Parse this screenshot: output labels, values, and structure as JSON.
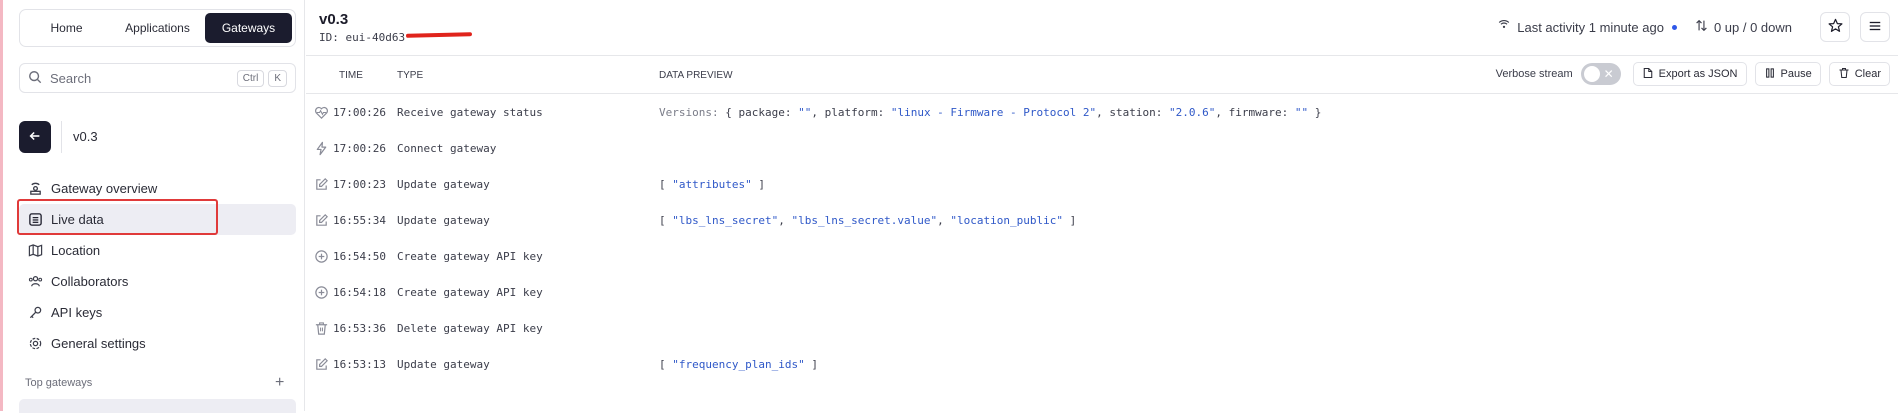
{
  "sidebar": {
    "tabs": [
      {
        "label": "Home"
      },
      {
        "label": "Applications"
      },
      {
        "label": "Gateways"
      }
    ],
    "search": {
      "placeholder": "Search",
      "key1": "Ctrl",
      "key2": "K"
    },
    "entity": {
      "name": "v0.3"
    },
    "nav": [
      {
        "label": "Gateway overview",
        "icon": "gateway-icon"
      },
      {
        "label": "Live data",
        "icon": "list-icon"
      },
      {
        "label": "Location",
        "icon": "map-icon"
      },
      {
        "label": "Collaborators",
        "icon": "users-icon"
      },
      {
        "label": "API keys",
        "icon": "key-icon"
      },
      {
        "label": "General settings",
        "icon": "gear-icon"
      }
    ],
    "section": {
      "title": "Top gateways"
    }
  },
  "header": {
    "title": "v0.3",
    "id_label": "ID:",
    "id_value": "eui-40d63",
    "activity": "Last activity 1 minute ago",
    "traffic": "0 up / 0 down"
  },
  "table": {
    "columns": {
      "time": "TIME",
      "type": "TYPE",
      "preview": "DATA PREVIEW"
    },
    "controls": {
      "verbose": "Verbose stream",
      "export": "Export as JSON",
      "pause": "Pause",
      "clear": "Clear"
    },
    "rows": [
      {
        "icon": "heartbeat-icon",
        "time": "17:00:26",
        "type": "Receive gateway status",
        "preview_prefix": "Versions: ",
        "preview": "{ package: \"\", platform: \"linux - Firmware - Protocol 2\", station: \"2.0.6\", firmware: \"\" }"
      },
      {
        "icon": "bolt-icon",
        "time": "17:00:26",
        "type": "Connect gateway",
        "preview_prefix": "",
        "preview": ""
      },
      {
        "icon": "edit-icon",
        "time": "17:00:23",
        "type": "Update gateway",
        "preview_prefix": "",
        "preview": "[ \"attributes\" ]"
      },
      {
        "icon": "edit-icon",
        "time": "16:55:34",
        "type": "Update gateway",
        "preview_prefix": "",
        "preview": "[ \"lbs_lns_secret\", \"lbs_lns_secret.value\", \"location_public\" ]"
      },
      {
        "icon": "plus-circle-icon",
        "time": "16:54:50",
        "type": "Create gateway API key",
        "preview_prefix": "",
        "preview": ""
      },
      {
        "icon": "plus-circle-icon",
        "time": "16:54:18",
        "type": "Create gateway API key",
        "preview_prefix": "",
        "preview": ""
      },
      {
        "icon": "trash-icon",
        "time": "16:53:36",
        "type": "Delete gateway API key",
        "preview_prefix": "",
        "preview": ""
      },
      {
        "icon": "edit-icon",
        "time": "16:53:13",
        "type": "Update gateway",
        "preview_prefix": "",
        "preview": "[ \"frequency_plan_ids\" ]"
      }
    ]
  },
  "colors": {
    "accent_dark": "#1b1c2e",
    "highlight_red": "#e03a3a",
    "string_blue": "#2f58c8",
    "activity_dot": "#2f58e8"
  }
}
